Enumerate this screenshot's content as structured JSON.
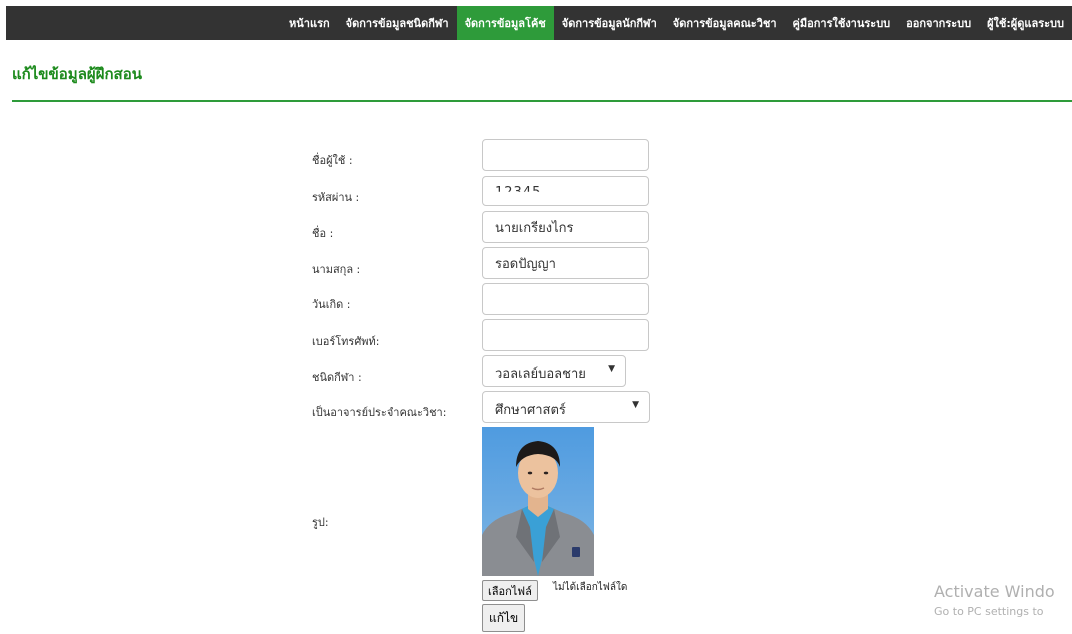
{
  "nav": {
    "items": [
      {
        "label": "หน้าแรก",
        "active": false
      },
      {
        "label": "จัดการข้อมูลชนิดกีฬา",
        "active": false
      },
      {
        "label": "จัดการข้อมูลโค้ช",
        "active": true
      },
      {
        "label": "จัดการข้อมูลนักกีฬา",
        "active": false
      },
      {
        "label": "จัดการข้อมูลคณะวิชา",
        "active": false
      },
      {
        "label": "คู่มือการใช้งานระบบ",
        "active": false
      },
      {
        "label": "ออกจากระบบ",
        "active": false
      },
      {
        "label": "ผู้ใช้:ผู้ดูแลระบบ",
        "active": false
      }
    ],
    "active_color": "#2e9b3a",
    "background": "#333333"
  },
  "page": {
    "title": "แก้ไขข้อมูลผู้ฝึกสอน",
    "title_color": "#1c8a1c"
  },
  "form": {
    "username": {
      "label": "ชื่อผู้ใช้ :",
      "value": ""
    },
    "password": {
      "label": "รหัสผ่าน :",
      "value": "12345"
    },
    "first_name": {
      "label": "ชื่อ :",
      "value": "นายเกรียงไกร"
    },
    "last_name": {
      "label": "นามสกุล :",
      "value": "รอดปัญญา"
    },
    "birthdate": {
      "label": "วันเกิด :",
      "value": ""
    },
    "phone": {
      "label": "เบอร์โทรศัพท์:",
      "value": ""
    },
    "sport_type": {
      "label": "ชนิดกีฬา :",
      "selected": "วอลเลย์บอลชาย"
    },
    "faculty": {
      "label": "เป็นอาจารย์ประจำคณะวิชา:",
      "selected": "ศึกษาศาสตร์"
    },
    "photo": {
      "label": "รูป:"
    },
    "file": {
      "button_label": "เลือกไฟล์",
      "status": "ไม่ได้เลือกไฟล์ใด"
    },
    "submit_label": "แก้ไข"
  },
  "watermark": {
    "title": "Activate Windo",
    "subtitle": "Go to PC settings to"
  }
}
